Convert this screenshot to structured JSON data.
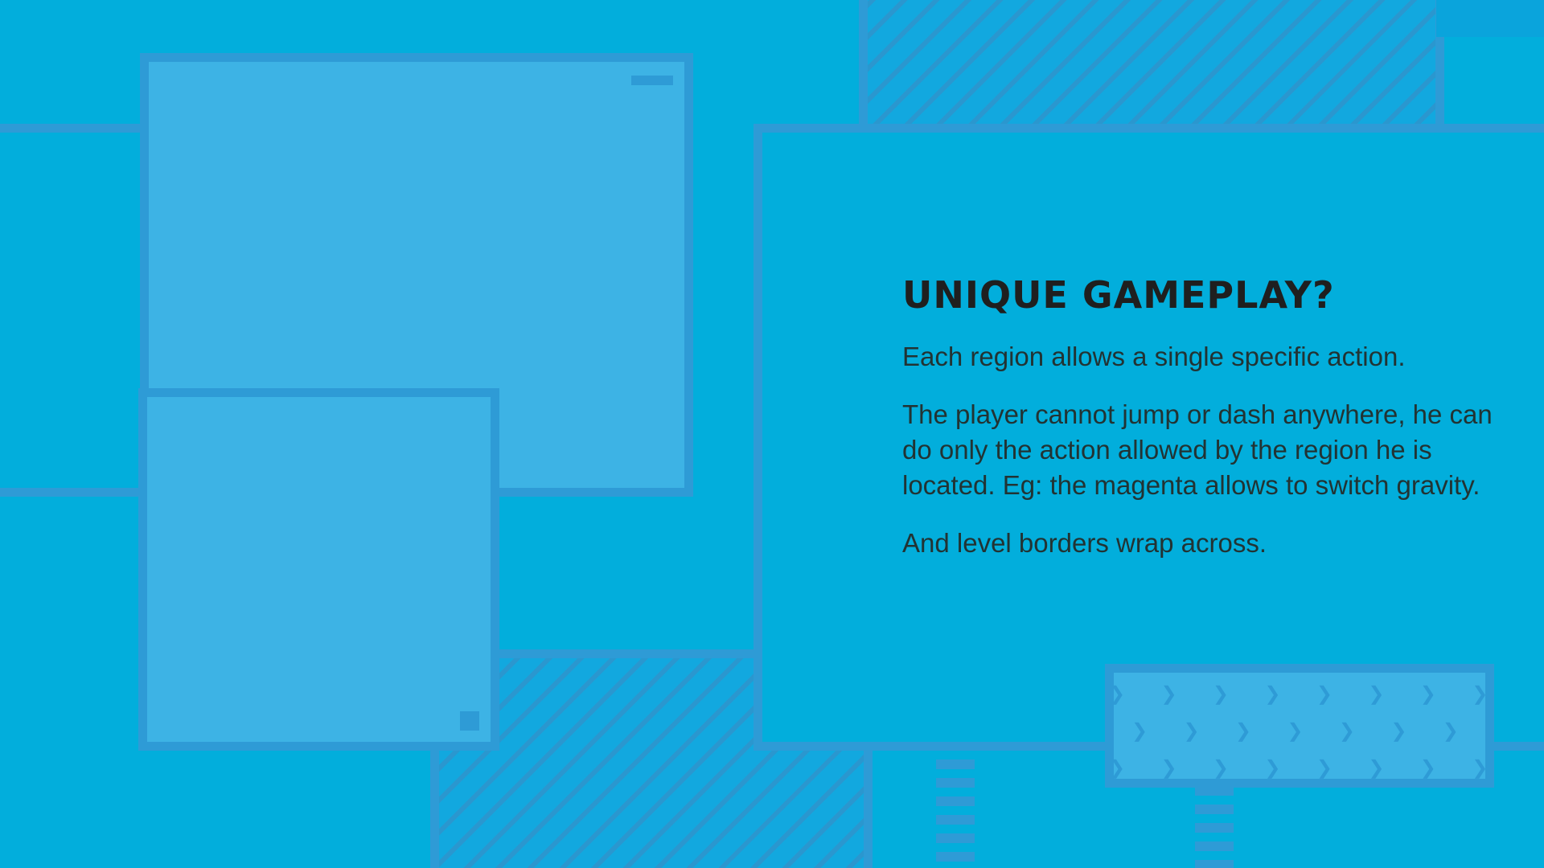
{
  "slide": {
    "title": "Unique Gameplay?",
    "paragraphs": [
      "Each region allows a single specific action.",
      "The player cannot jump or dash anywhere, he can do only the action allowed by the region he is located. Eg: the magenta allows to switch gravity.",
      "And level borders wrap across."
    ]
  },
  "decor": {
    "arrow_glyph": "❯ ❯ ❯ ❯ ❯ ❯ ❯ ❯ ❯ ❯ ❯"
  },
  "colors": {
    "background": "#02aedc",
    "block_light": "#3db3e5",
    "border": "#2e9bd6",
    "text": "#222222"
  }
}
